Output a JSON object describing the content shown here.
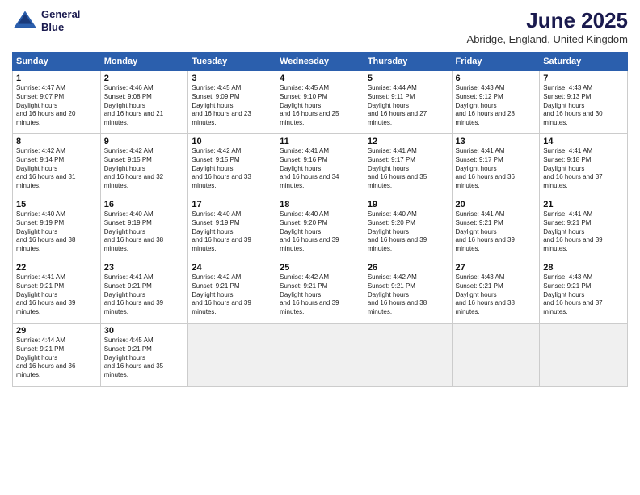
{
  "header": {
    "logo_line1": "General",
    "logo_line2": "Blue",
    "month_title": "June 2025",
    "location": "Abridge, England, United Kingdom"
  },
  "columns": [
    "Sunday",
    "Monday",
    "Tuesday",
    "Wednesday",
    "Thursday",
    "Friday",
    "Saturday"
  ],
  "weeks": [
    [
      {
        "day": "1",
        "sunrise": "4:47 AM",
        "sunset": "9:07 PM",
        "daylight": "16 hours and 20 minutes."
      },
      {
        "day": "2",
        "sunrise": "4:46 AM",
        "sunset": "9:08 PM",
        "daylight": "16 hours and 21 minutes."
      },
      {
        "day": "3",
        "sunrise": "4:45 AM",
        "sunset": "9:09 PM",
        "daylight": "16 hours and 23 minutes."
      },
      {
        "day": "4",
        "sunrise": "4:45 AM",
        "sunset": "9:10 PM",
        "daylight": "16 hours and 25 minutes."
      },
      {
        "day": "5",
        "sunrise": "4:44 AM",
        "sunset": "9:11 PM",
        "daylight": "16 hours and 27 minutes."
      },
      {
        "day": "6",
        "sunrise": "4:43 AM",
        "sunset": "9:12 PM",
        "daylight": "16 hours and 28 minutes."
      },
      {
        "day": "7",
        "sunrise": "4:43 AM",
        "sunset": "9:13 PM",
        "daylight": "16 hours and 30 minutes."
      }
    ],
    [
      {
        "day": "8",
        "sunrise": "4:42 AM",
        "sunset": "9:14 PM",
        "daylight": "16 hours and 31 minutes."
      },
      {
        "day": "9",
        "sunrise": "4:42 AM",
        "sunset": "9:15 PM",
        "daylight": "16 hours and 32 minutes."
      },
      {
        "day": "10",
        "sunrise": "4:42 AM",
        "sunset": "9:15 PM",
        "daylight": "16 hours and 33 minutes."
      },
      {
        "day": "11",
        "sunrise": "4:41 AM",
        "sunset": "9:16 PM",
        "daylight": "16 hours and 34 minutes."
      },
      {
        "day": "12",
        "sunrise": "4:41 AM",
        "sunset": "9:17 PM",
        "daylight": "16 hours and 35 minutes."
      },
      {
        "day": "13",
        "sunrise": "4:41 AM",
        "sunset": "9:17 PM",
        "daylight": "16 hours and 36 minutes."
      },
      {
        "day": "14",
        "sunrise": "4:41 AM",
        "sunset": "9:18 PM",
        "daylight": "16 hours and 37 minutes."
      }
    ],
    [
      {
        "day": "15",
        "sunrise": "4:40 AM",
        "sunset": "9:19 PM",
        "daylight": "16 hours and 38 minutes."
      },
      {
        "day": "16",
        "sunrise": "4:40 AM",
        "sunset": "9:19 PM",
        "daylight": "16 hours and 38 minutes."
      },
      {
        "day": "17",
        "sunrise": "4:40 AM",
        "sunset": "9:19 PM",
        "daylight": "16 hours and 39 minutes."
      },
      {
        "day": "18",
        "sunrise": "4:40 AM",
        "sunset": "9:20 PM",
        "daylight": "16 hours and 39 minutes."
      },
      {
        "day": "19",
        "sunrise": "4:40 AM",
        "sunset": "9:20 PM",
        "daylight": "16 hours and 39 minutes."
      },
      {
        "day": "20",
        "sunrise": "4:41 AM",
        "sunset": "9:21 PM",
        "daylight": "16 hours and 39 minutes."
      },
      {
        "day": "21",
        "sunrise": "4:41 AM",
        "sunset": "9:21 PM",
        "daylight": "16 hours and 39 minutes."
      }
    ],
    [
      {
        "day": "22",
        "sunrise": "4:41 AM",
        "sunset": "9:21 PM",
        "daylight": "16 hours and 39 minutes."
      },
      {
        "day": "23",
        "sunrise": "4:41 AM",
        "sunset": "9:21 PM",
        "daylight": "16 hours and 39 minutes."
      },
      {
        "day": "24",
        "sunrise": "4:42 AM",
        "sunset": "9:21 PM",
        "daylight": "16 hours and 39 minutes."
      },
      {
        "day": "25",
        "sunrise": "4:42 AM",
        "sunset": "9:21 PM",
        "daylight": "16 hours and 39 minutes."
      },
      {
        "day": "26",
        "sunrise": "4:42 AM",
        "sunset": "9:21 PM",
        "daylight": "16 hours and 38 minutes."
      },
      {
        "day": "27",
        "sunrise": "4:43 AM",
        "sunset": "9:21 PM",
        "daylight": "16 hours and 38 minutes."
      },
      {
        "day": "28",
        "sunrise": "4:43 AM",
        "sunset": "9:21 PM",
        "daylight": "16 hours and 37 minutes."
      }
    ],
    [
      {
        "day": "29",
        "sunrise": "4:44 AM",
        "sunset": "9:21 PM",
        "daylight": "16 hours and 36 minutes."
      },
      {
        "day": "30",
        "sunrise": "4:45 AM",
        "sunset": "9:21 PM",
        "daylight": "16 hours and 35 minutes."
      },
      null,
      null,
      null,
      null,
      null
    ]
  ]
}
